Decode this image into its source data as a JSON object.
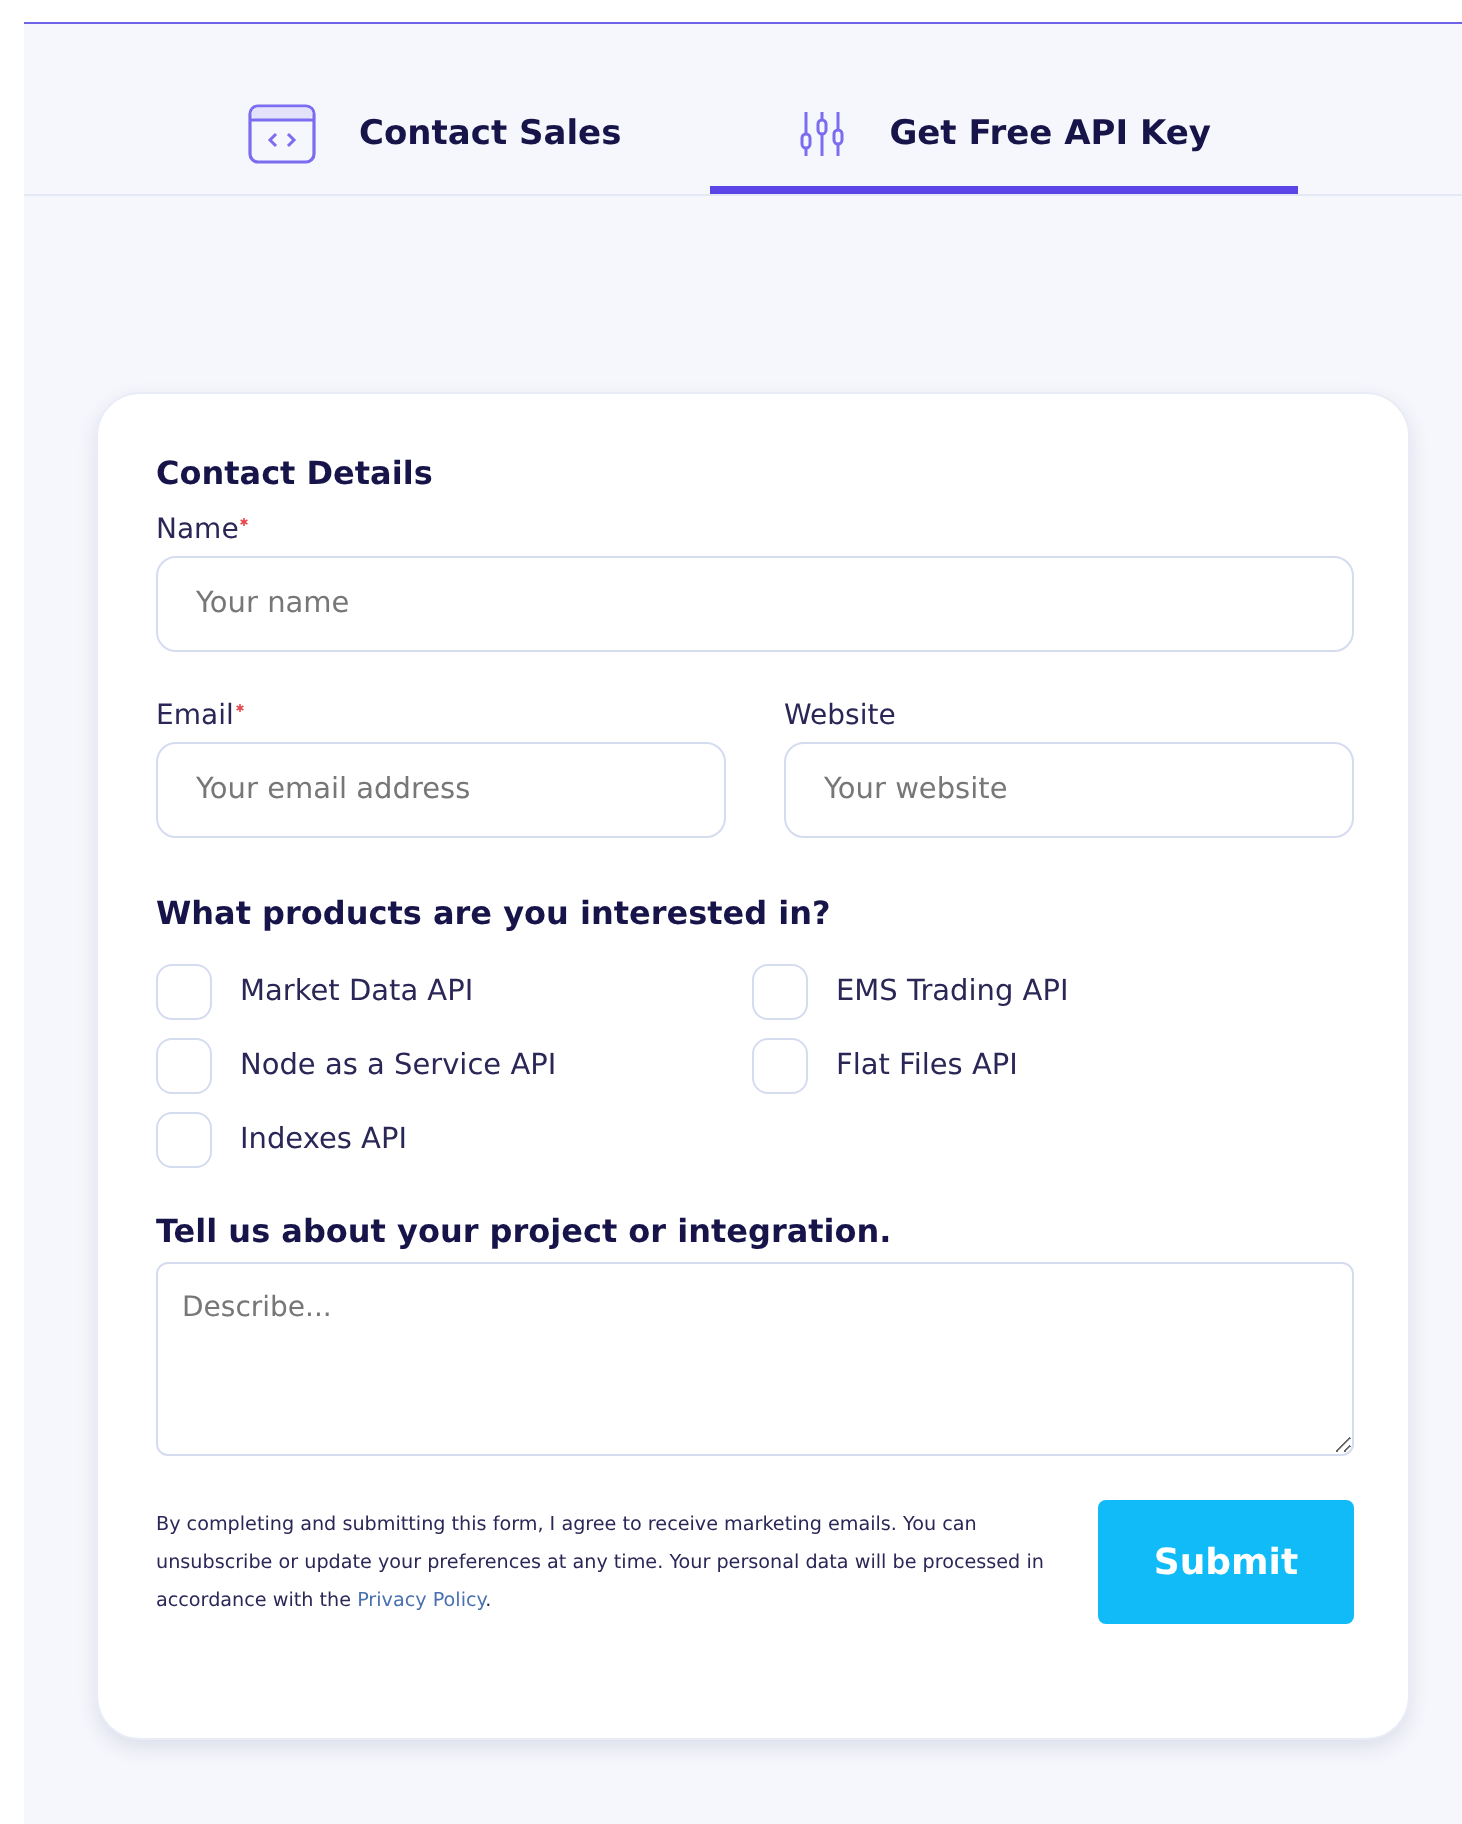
{
  "tabs": [
    {
      "label": "Contact Sales",
      "kind": "code",
      "selected": false
    },
    {
      "label": "Get Free API Key",
      "kind": "sliders",
      "selected": true
    }
  ],
  "form": {
    "title": "Contact Details",
    "fields": [
      {
        "label": "Name",
        "placeholder": "Your name",
        "required": true,
        "kind": "wide"
      },
      {
        "label": "Email",
        "placeholder": "Your email address",
        "required": true,
        "kind": "half"
      },
      {
        "label": "Website",
        "placeholder": "Your website",
        "required": false,
        "kind": "half"
      }
    ],
    "products_title": "What products are you interested in?",
    "products": [
      {
        "label": "Market Data API",
        "checked": false
      },
      {
        "label": "EMS Trading API",
        "checked": false
      },
      {
        "label": "Node as a Service API",
        "checked": false
      },
      {
        "label": "Flat Files API",
        "checked": false
      },
      {
        "label": "Indexes API",
        "checked": false
      }
    ],
    "project_title": "Tell us about your project or integration.",
    "project_placeholder": "Describe...",
    "consent": {
      "text": "By completing and submitting this form, I agree to receive marketing emails. You can unsubscribe or update your preferences at any time. Your personal data will be processed in accordance with the",
      "link": "Privacy Policy",
      "after": "."
    },
    "submit": "Submit"
  }
}
